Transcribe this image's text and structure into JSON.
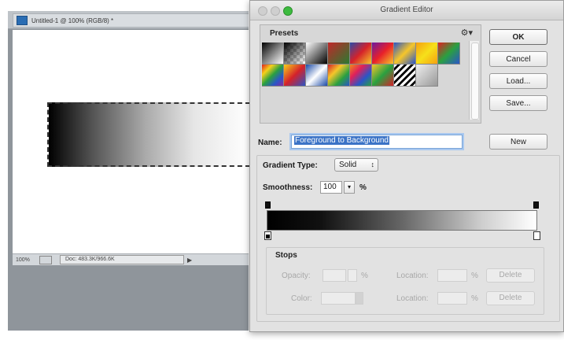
{
  "document": {
    "title": "Untitled-1 @ 100% (RGB/8) *",
    "zoom": "100%",
    "doc_info": "Doc: 483.3K/966.6K"
  },
  "dialog": {
    "title": "Gradient Editor",
    "presets_label": "Presets",
    "buttons": {
      "ok": "OK",
      "cancel": "Cancel",
      "load": "Load...",
      "save": "Save..."
    },
    "name_label": "Name:",
    "name_value": "Foreground to Background",
    "new_button": "New",
    "gradient_type_label": "Gradient Type:",
    "gradient_type_value": "Solid",
    "smoothness_label": "Smoothness:",
    "smoothness_value": "100",
    "percent": "%",
    "stops": {
      "label": "Stops",
      "opacity_label": "Opacity:",
      "location_label": "Location:",
      "color_label": "Color:",
      "delete_label": "Delete",
      "percent": "%"
    }
  },
  "presets": [
    "linear-gradient(135deg,#000,#fff)",
    "linear-gradient(135deg,#000 0%,transparent 100%),repeating-conic-gradient(#ccc 0 25%,#fff 0 50%) 0 0/8px 8px",
    "linear-gradient(135deg,#fff,#000)",
    "linear-gradient(135deg,#c0282a,#2a7a30)",
    "linear-gradient(135deg,#2c4aa8,#d5222a,#f6c62a)",
    "linear-gradient(135deg,#6a1aa0,#e8202a,#f6c62a)",
    "linear-gradient(135deg,#2a55c8,#f6c62a 50%,#2a55c8)",
    "linear-gradient(135deg,#f6a010,#f6e01a,#f6a010)",
    "linear-gradient(135deg,#e02020,#2aa040,#2a55c8)",
    "linear-gradient(135deg,#e02020,#f6d01a,#2aa040,#2a55c8,#8a2aa0)",
    "linear-gradient(135deg,#f6d01a,#d5222a,#2a55c8)",
    "linear-gradient(135deg,#1a4aa8,#fff 50%,#1a4aa8)",
    "linear-gradient(135deg,#d5222a,#f6c62a,#2aa040,#2a55c8)",
    "linear-gradient(135deg,#f08a1a,#e0205a,#2a55c8,#2aa040)",
    "linear-gradient(135deg,#f6c62a,#2aa040,#d5222a)",
    "repeating-linear-gradient(135deg,#fff 0 3px,#000 3px 6px)",
    "linear-gradient(135deg,#eee,#999),repeating-conic-gradient(#ccc 0 25%,#fff 0 50%) 0 0/8px 8px"
  ]
}
